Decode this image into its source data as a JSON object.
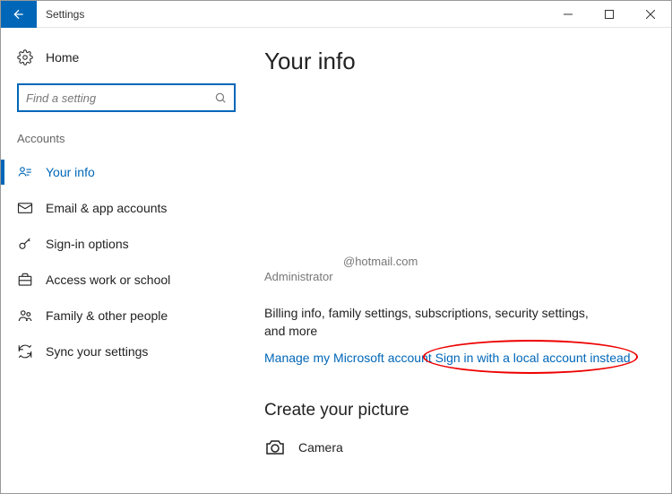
{
  "titlebar": {
    "title": "Settings"
  },
  "sidebar": {
    "home_label": "Home",
    "search_placeholder": "Find a setting",
    "category": "Accounts",
    "items": [
      {
        "label": "Your info"
      },
      {
        "label": "Email & app accounts"
      },
      {
        "label": "Sign-in options"
      },
      {
        "label": "Access work or school"
      },
      {
        "label": "Family & other people"
      },
      {
        "label": "Sync your settings"
      }
    ]
  },
  "main": {
    "heading": "Your info",
    "email": "@hotmail.com",
    "role": "Administrator",
    "billing_text": "Billing info, family settings, subscriptions, security settings, and more",
    "manage_link": "Manage my Microsoft account",
    "local_account_link": "Sign in with a local account instead",
    "picture_heading": "Create your picture",
    "camera_label": "Camera"
  }
}
